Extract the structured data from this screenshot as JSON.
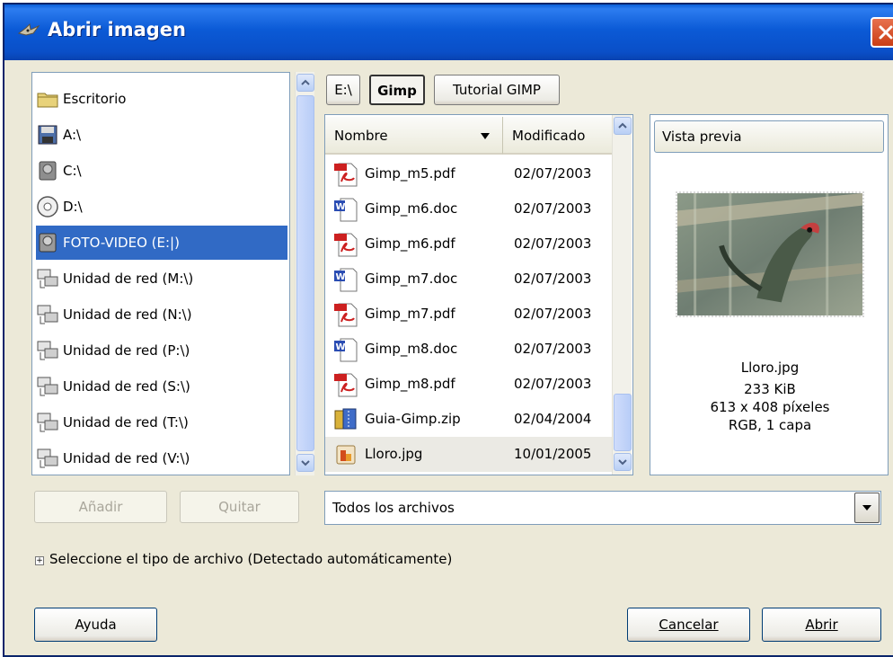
{
  "window": {
    "title": "Abrir imagen",
    "colors": {
      "titlebar": "#0a5fd8",
      "selection": "#316ac5",
      "close": "#d44a20"
    }
  },
  "places": [
    {
      "label": "Escritorio",
      "icon": "folder-icon"
    },
    {
      "label": "A:\\",
      "icon": "floppy-icon"
    },
    {
      "label": "C:\\",
      "icon": "hard-drive-icon"
    },
    {
      "label": "D:\\",
      "icon": "cd-drive-icon"
    },
    {
      "label": "FOTO-VIDEO (E:|)",
      "icon": "hard-drive-icon",
      "selected": true
    },
    {
      "label": "Unidad de red (M:\\)",
      "icon": "network-drive-icon"
    },
    {
      "label": "Unidad de red (N:\\)",
      "icon": "network-drive-icon"
    },
    {
      "label": "Unidad de red (P:\\)",
      "icon": "network-drive-icon"
    },
    {
      "label": "Unidad de red (S:\\)",
      "icon": "network-drive-icon"
    },
    {
      "label": "Unidad de red (T:\\)",
      "icon": "network-drive-icon"
    },
    {
      "label": "Unidad de red (V:\\)",
      "icon": "network-drive-icon"
    }
  ],
  "place_buttons": {
    "add": "Añadir",
    "remove": "Quitar"
  },
  "path": {
    "root": "E:\\",
    "current": "Gimp",
    "child": "Tutorial GIMP"
  },
  "files": {
    "col_name": "Nombre",
    "col_modified": "Modificado",
    "rows": [
      {
        "name": "Gimp_m5.pdf",
        "date": "02/07/2003",
        "icon": "pdf-file-icon"
      },
      {
        "name": "Gimp_m6.doc",
        "date": "02/07/2003",
        "icon": "word-file-icon"
      },
      {
        "name": "Gimp_m6.pdf",
        "date": "02/07/2003",
        "icon": "pdf-file-icon"
      },
      {
        "name": "Gimp_m7.doc",
        "date": "02/07/2003",
        "icon": "word-file-icon"
      },
      {
        "name": "Gimp_m7.pdf",
        "date": "02/07/2003",
        "icon": "pdf-file-icon"
      },
      {
        "name": "Gimp_m8.doc",
        "date": "02/07/2003",
        "icon": "word-file-icon"
      },
      {
        "name": "Gimp_m8.pdf",
        "date": "02/07/2003",
        "icon": "pdf-file-icon"
      },
      {
        "name": "Guia-Gimp.zip",
        "date": "02/04/2004",
        "icon": "zip-file-icon"
      },
      {
        "name": "Lloro.jpg",
        "date": "10/01/2005",
        "icon": "image-file-icon",
        "selected": true
      }
    ]
  },
  "preview": {
    "header": "Vista previa",
    "filename": "Lloro.jpg",
    "size": "233 KiB",
    "dimensions": "613 x 408 píxeles",
    "mode": "RGB, 1 capa"
  },
  "filter": {
    "value": "Todos los archivos"
  },
  "file_type": {
    "label": "Seleccione el tipo de archivo  (Detectado automáticamente)"
  },
  "actions": {
    "help": "Ayuda",
    "cancel": "Cancelar",
    "open": "Abrir"
  }
}
